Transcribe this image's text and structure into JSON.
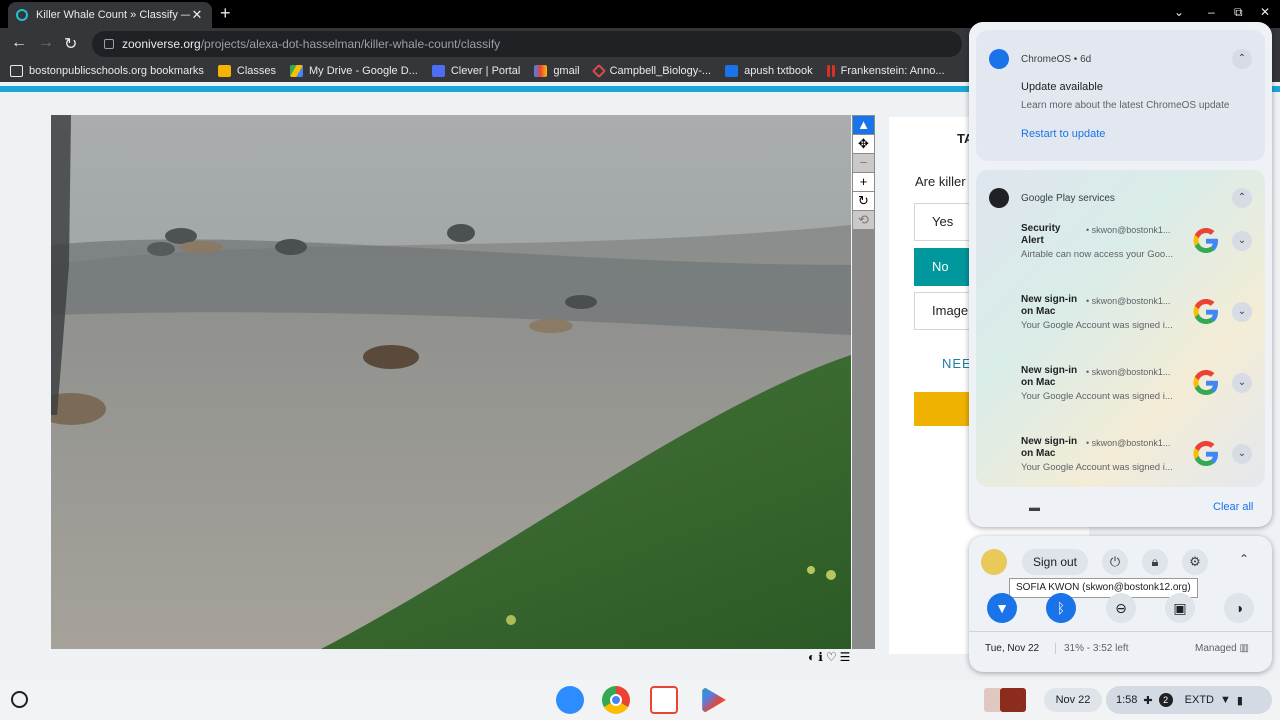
{
  "browser": {
    "tab_title": "Killer Whale Count » Classify — Z",
    "url_host": "zooniverse.org",
    "url_path": "/projects/alexa-dot-hasselman/killer-whale-count/classify",
    "bookmarks": [
      {
        "label": "bostonpublicschools.org bookmarks",
        "color": "#9aa0a6"
      },
      {
        "label": "Classes",
        "color": "#f4b400"
      },
      {
        "label": "My Drive - Google D...",
        "color": "#34a853"
      },
      {
        "label": "Clever | Portal",
        "color": "#4c6ef5"
      },
      {
        "label": "gmail",
        "color": "#ea4335"
      },
      {
        "label": "Campbell_Biology-...",
        "color": "#e04848"
      },
      {
        "label": "apush txtbook",
        "color": "#1a73e8"
      },
      {
        "label": "Frankenstein: Anno...",
        "color": "#d93025"
      }
    ]
  },
  "classifier": {
    "task_header": "TA",
    "question": "Are killer",
    "answers": [
      "Yes",
      "No",
      "Image"
    ],
    "selected": "No",
    "need_help": "NEE"
  },
  "notifications": {
    "chromeos": {
      "app": "ChromeOS • 6d",
      "title": "Update available",
      "body": "Learn more about the latest ChromeOS update",
      "action": "Restart to update"
    },
    "play": {
      "app": "Google Play services",
      "items": [
        {
          "title": "Security Alert",
          "account": "• skwon@bostonk1...",
          "body": "Airtable can now access your Goo..."
        },
        {
          "title": "New sign-in on Mac",
          "account": "• skwon@bostonk1...",
          "body": "Your Google Account was signed i..."
        },
        {
          "title": "New sign-in on Mac",
          "account": "• skwon@bostonk1...",
          "body": "Your Google Account was signed i..."
        },
        {
          "title": "New sign-in on Mac",
          "account": "• skwon@bostonk1...",
          "body": "Your Google Account was signed i..."
        }
      ]
    },
    "clear_all": "Clear all"
  },
  "quick_settings": {
    "sign_out": "Sign out",
    "tooltip": "SOFIA KWON (skwon@bostonk12.org)",
    "date": "Tue, Nov 22",
    "battery": "31% - 3:52 left",
    "managed": "Managed"
  },
  "shelf": {
    "date": "Nov 22",
    "time": "1:58",
    "notif_count": "2",
    "display": "EXTD"
  }
}
